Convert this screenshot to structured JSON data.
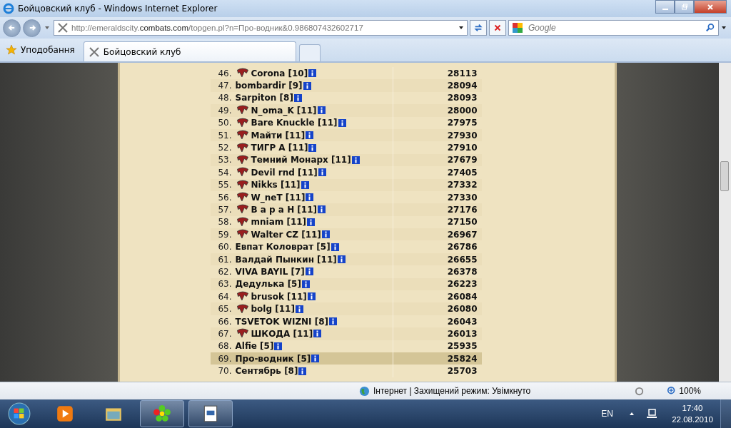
{
  "window": {
    "title": "Бойцовский клуб - Windows Internet Explorer"
  },
  "address": {
    "prefix": "http://emeraldscity.",
    "domain": "combats.com",
    "path": "/topgen.pl?n=Про-водник&0.986807432602717"
  },
  "search": {
    "placeholder": "Google"
  },
  "favorites": {
    "label": "Уподобання"
  },
  "tabs": [
    {
      "label": "Бойцовский клуб",
      "selected": true
    }
  ],
  "ranking": {
    "rows": [
      {
        "rank": "46.",
        "name": "Corona [10]",
        "emblem": true,
        "score": "28113",
        "selected": false
      },
      {
        "rank": "47.",
        "name": "bombardir [9]",
        "emblem": false,
        "score": "28094",
        "selected": false
      },
      {
        "rank": "48.",
        "name": "Sarpiton [8]",
        "emblem": false,
        "score": "28093",
        "selected": false
      },
      {
        "rank": "49.",
        "name": "N_oma_K [11]",
        "emblem": true,
        "score": "28000",
        "selected": false
      },
      {
        "rank": "50.",
        "name": "Bare Knuckle [11]",
        "emblem": true,
        "score": "27975",
        "selected": false
      },
      {
        "rank": "51.",
        "name": "Майти [11]",
        "emblem": true,
        "score": "27930",
        "selected": false
      },
      {
        "rank": "52.",
        "name": "ТИГР А [11]",
        "emblem": true,
        "score": "27910",
        "selected": false
      },
      {
        "rank": "53.",
        "name": "Темний Монарх [11]",
        "emblem": true,
        "score": "27679",
        "selected": false
      },
      {
        "rank": "54.",
        "name": "Devil rnd [11]",
        "emblem": true,
        "score": "27405",
        "selected": false
      },
      {
        "rank": "55.",
        "name": "Nikks [11]",
        "emblem": true,
        "score": "27332",
        "selected": false
      },
      {
        "rank": "56.",
        "name": "W_neT [11]",
        "emblem": true,
        "score": "27330",
        "selected": false
      },
      {
        "rank": "57.",
        "name": "В а р а Н [11]",
        "emblem": true,
        "score": "27176",
        "selected": false
      },
      {
        "rank": "58.",
        "name": "mniam [11]",
        "emblem": true,
        "score": "27150",
        "selected": false
      },
      {
        "rank": "59.",
        "name": "Walter CZ [11]",
        "emblem": true,
        "score": "26967",
        "selected": false
      },
      {
        "rank": "60.",
        "name": "Евпат Коловрат [5]",
        "emblem": false,
        "score": "26786",
        "selected": false
      },
      {
        "rank": "61.",
        "name": "Валдай Пынкин [11]",
        "emblem": false,
        "score": "26655",
        "selected": false
      },
      {
        "rank": "62.",
        "name": "VIVA BAYIL [7]",
        "emblem": false,
        "score": "26378",
        "selected": false
      },
      {
        "rank": "63.",
        "name": "Дедулька [5]",
        "emblem": false,
        "score": "26223",
        "selected": false
      },
      {
        "rank": "64.",
        "name": "brusok [11]",
        "emblem": true,
        "score": "26084",
        "selected": false
      },
      {
        "rank": "65.",
        "name": "bolg [11]",
        "emblem": true,
        "score": "26080",
        "selected": false
      },
      {
        "rank": "66.",
        "name": "TSVETOK WIZNI [8]",
        "emblem": false,
        "score": "26043",
        "selected": false
      },
      {
        "rank": "67.",
        "name": "ШКОДА [11]",
        "emblem": true,
        "score": "26013",
        "selected": false
      },
      {
        "rank": "68.",
        "name": "Alfie [5]",
        "emblem": false,
        "score": "25935",
        "selected": false
      },
      {
        "rank": "69.",
        "name": "Про-водник [5]",
        "emblem": false,
        "score": "25824",
        "selected": true
      },
      {
        "rank": "70.",
        "name": "Сентябрь [8]",
        "emblem": false,
        "score": "25703",
        "selected": false
      }
    ]
  },
  "status_bar": {
    "zone": "Інтернет | Захищений режим: Увімкнуто",
    "zoom": "100%"
  },
  "taskbar": {
    "language": "EN",
    "time": "17:40",
    "date": "22.08.2010"
  }
}
